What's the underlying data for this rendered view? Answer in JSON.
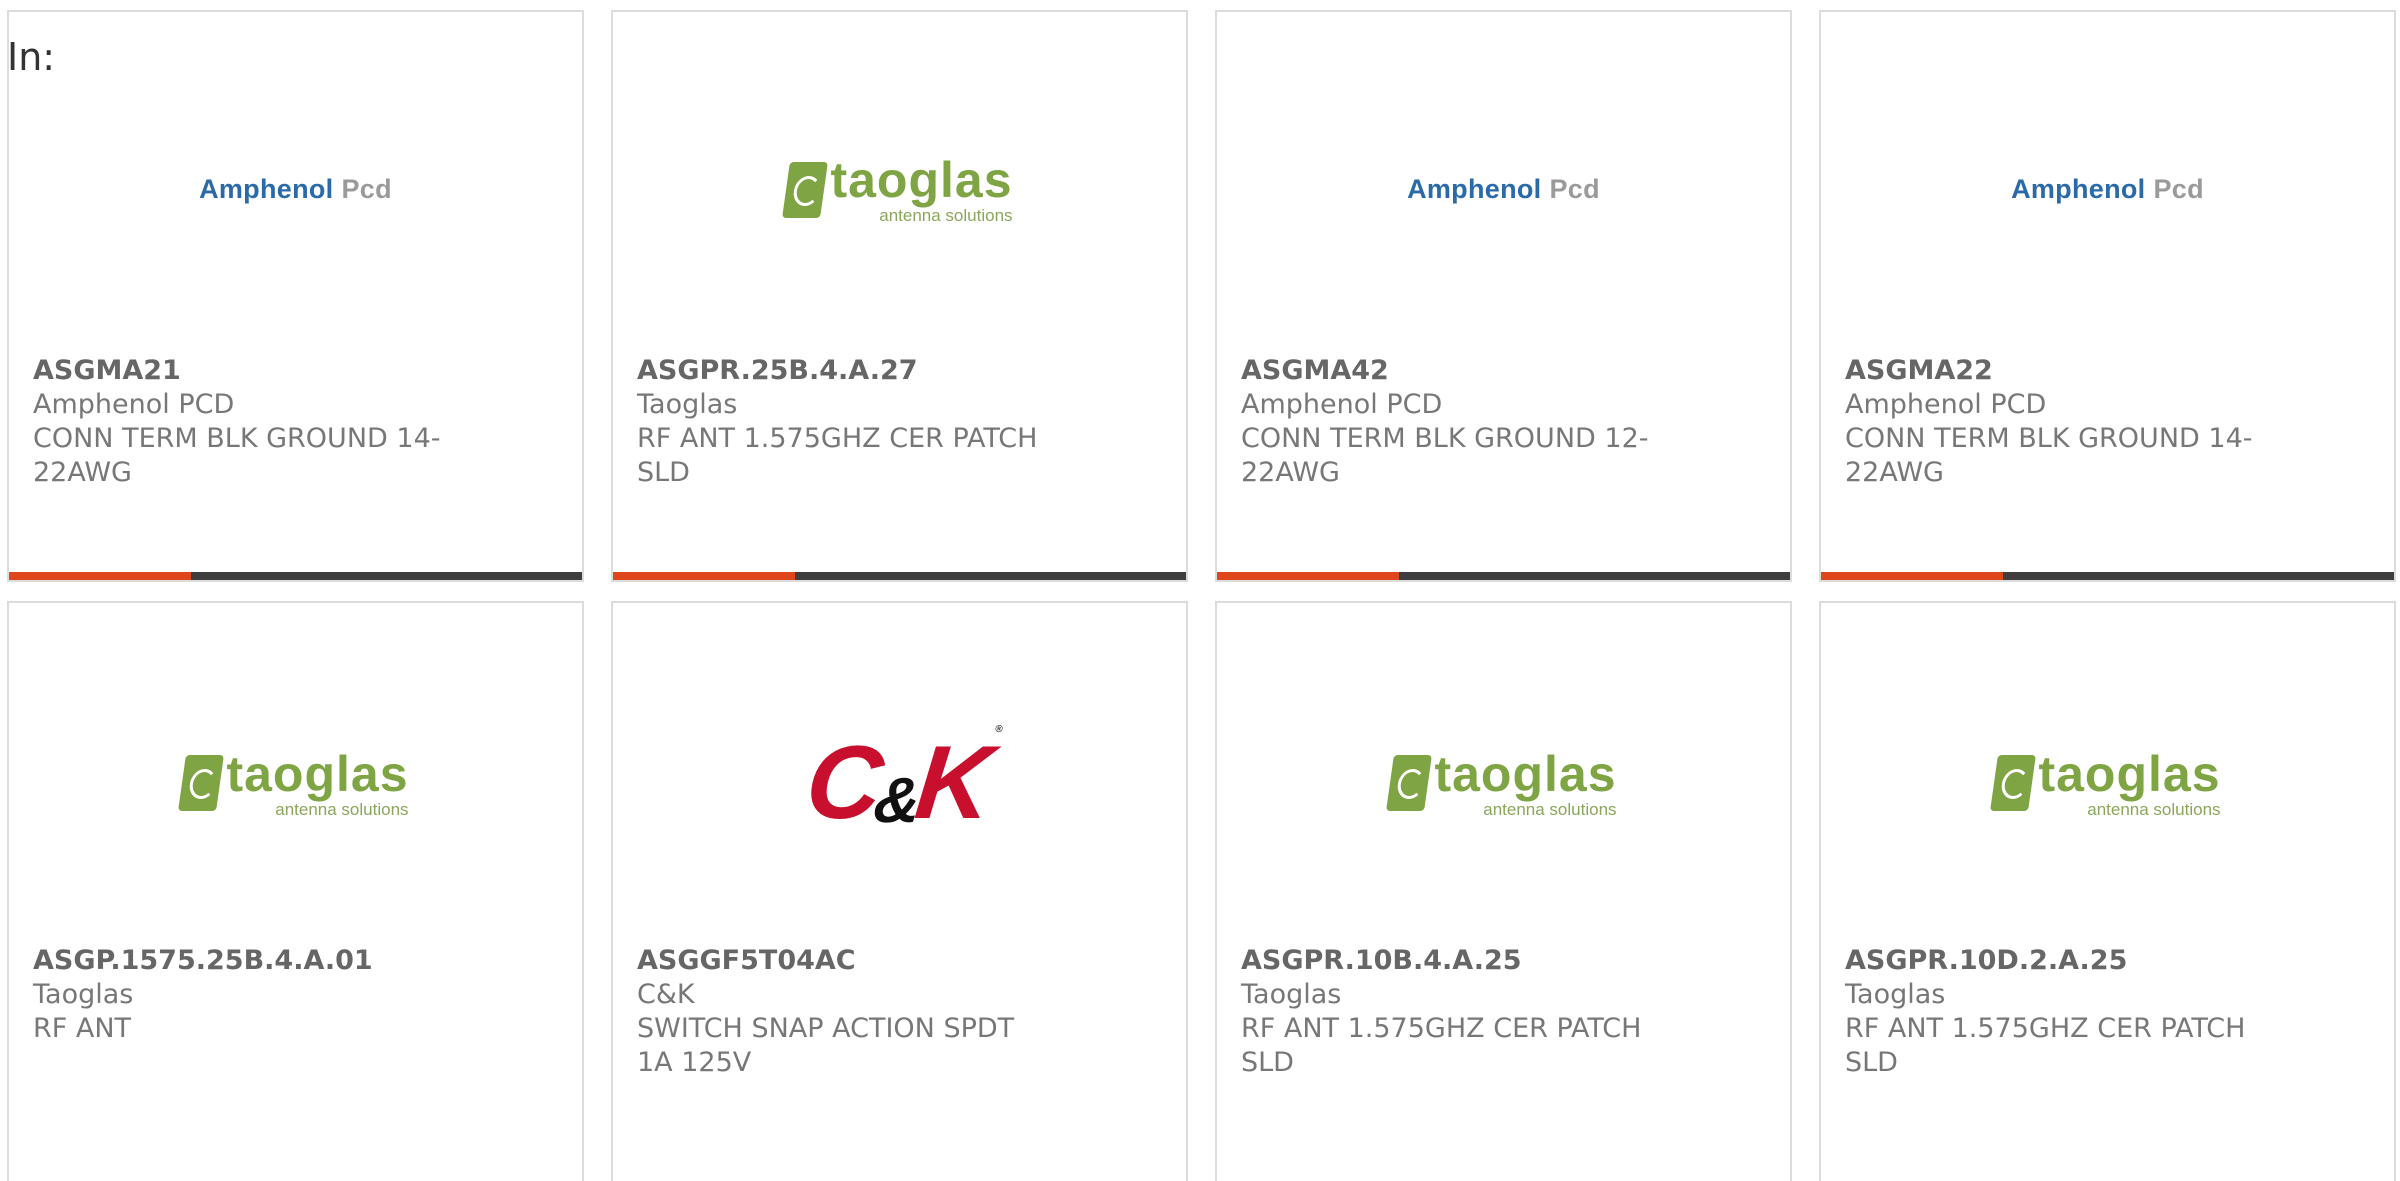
{
  "filter": {
    "label": "In:"
  },
  "products": [
    {
      "part": "ASGMA21",
      "manufacturer": "Amphenol PCD",
      "description": "CONN TERM BLK GROUND 14-22AWG",
      "logo": "amphenol",
      "logo_text_a": "Amphenol",
      "logo_text_b": "Pcd"
    },
    {
      "part": "ASGPR.25B.4.A.27",
      "manufacturer": "Taoglas",
      "description": "RF ANT 1.575GHZ CER PATCH SLD",
      "logo": "taoglas",
      "logo_name": "taoglas",
      "logo_sub": "antenna solutions"
    },
    {
      "part": "ASGMA42",
      "manufacturer": "Amphenol PCD",
      "description": "CONN TERM BLK GROUND 12-22AWG",
      "logo": "amphenol",
      "logo_text_a": "Amphenol",
      "logo_text_b": "Pcd"
    },
    {
      "part": "ASGMA22",
      "manufacturer": "Amphenol PCD",
      "description": "CONN TERM BLK GROUND 14-22AWG",
      "logo": "amphenol",
      "logo_text_a": "Amphenol",
      "logo_text_b": "Pcd"
    },
    {
      "part": "ASGP.1575.25B.4.A.01",
      "manufacturer": "Taoglas",
      "description": "RF ANT",
      "logo": "taoglas",
      "logo_name": "taoglas",
      "logo_sub": "antenna solutions"
    },
    {
      "part": "ASGGF5T04AC",
      "manufacturer": "C&K",
      "description": "SWITCH SNAP ACTION SPDT 1A 125V",
      "logo": "ck"
    },
    {
      "part": "ASGPR.10B.4.A.25",
      "manufacturer": "Taoglas",
      "description": "RF ANT 1.575GHZ CER PATCH SLD",
      "logo": "taoglas",
      "logo_name": "taoglas",
      "logo_sub": "antenna solutions"
    },
    {
      "part": "ASGPR.10D.2.A.25",
      "manufacturer": "Taoglas",
      "description": "RF ANT 1.575GHZ CER PATCH SLD",
      "logo": "taoglas",
      "logo_name": "taoglas",
      "logo_sub": "antenna solutions"
    }
  ],
  "colors": {
    "accent": "#e0461c",
    "bar": "#3e3e3e",
    "amphenol_blue": "#2a6aa8",
    "taoglas_green": "#7fa443",
    "ck_red": "#c8102e"
  }
}
